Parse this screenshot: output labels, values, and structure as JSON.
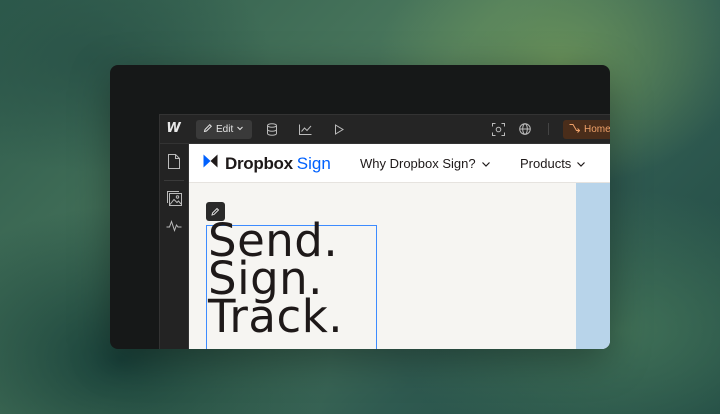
{
  "editor": {
    "logo": "W",
    "edit_label": "Edit",
    "home_label": "Homep",
    "icons": [
      "webflow-logo-icon",
      "pencil-icon",
      "chevron-down-icon",
      "database-icon",
      "analytics-icon",
      "play-icon",
      "screenshot-icon",
      "globe-icon",
      "branch-icon"
    ],
    "sidebar_icons": [
      "page-icon",
      "assets-icon",
      "activity-icon"
    ]
  },
  "site": {
    "brand_dropbox": "Dropbox",
    "brand_sign": "Sign",
    "nav": [
      "Why Dropbox Sign?",
      "Products"
    ],
    "hero_lines": [
      "Send.",
      "Sign.",
      "Track."
    ]
  },
  "colors": {
    "accent_orange": "#f0a26a",
    "brand_blue": "#0061fe",
    "selection_blue": "#3d8bff",
    "panel_blue": "#b8d4ea"
  }
}
